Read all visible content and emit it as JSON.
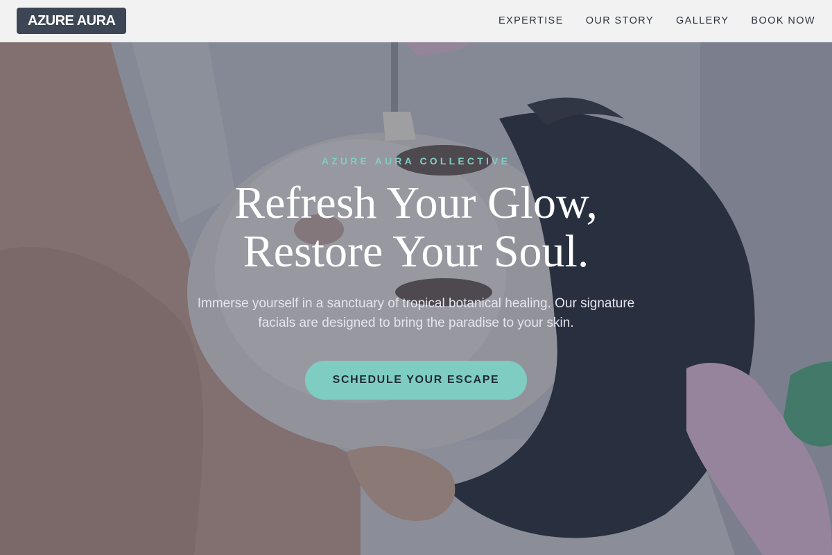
{
  "header": {
    "logo": "AZURE AURA",
    "nav": [
      {
        "label": "EXPERTISE"
      },
      {
        "label": "OUR STORY"
      },
      {
        "label": "GALLERY"
      },
      {
        "label": "BOOK NOW"
      }
    ]
  },
  "hero": {
    "eyebrow": "AZURE AURA COLLECTIVE",
    "headline_line1": "Refresh Your Glow,",
    "headline_line2": "Restore Your Soul.",
    "subtext": "Immerse yourself in a sanctuary of tropical botanical healing. Our signature facials are designed to bring the paradise to your skin.",
    "cta_label": "SCHEDULE YOUR ESCAPE"
  },
  "colors": {
    "accent": "#7fcdc2",
    "logo_bg": "#3c4654",
    "header_bg": "#f2f2f3"
  }
}
